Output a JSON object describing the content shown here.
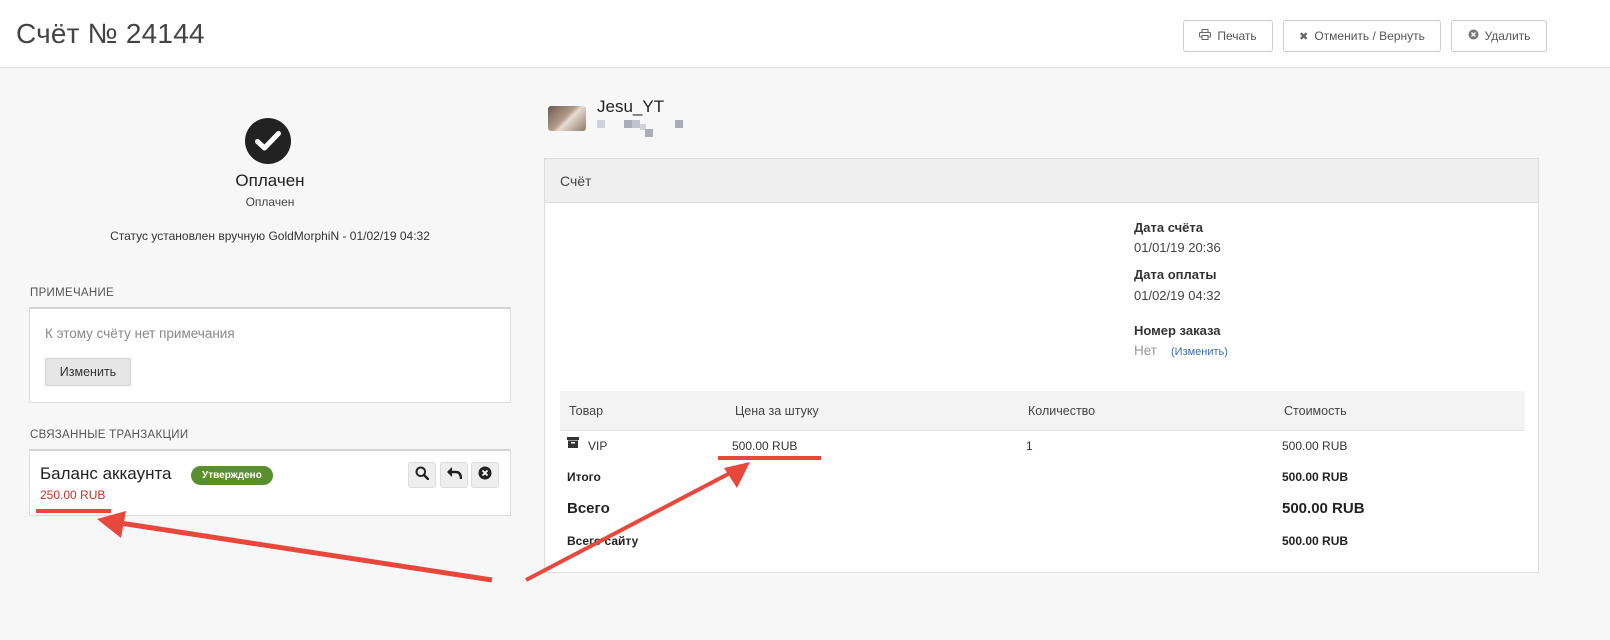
{
  "header": {
    "title": "Счёт № 24144",
    "buttons": {
      "print": "Печать",
      "cancel_refund": "Отменить / Вернуть",
      "delete": "Удалить"
    }
  },
  "status": {
    "title": "Оплачен",
    "subtitle": "Оплачен",
    "note": "Статус установлен вручную GoldMorphiN - 01/02/19 04:32"
  },
  "note_section": {
    "label": "ПРИМЕЧАНИЕ",
    "text": "К этому счёту нет примечания",
    "edit_button": "Изменить"
  },
  "transactions": {
    "label": "СВЯЗАННЫЕ ТРАНЗАКЦИИ",
    "items": [
      {
        "title": "Баланс аккаунта",
        "badge": "Утверждено",
        "amount": "250.00 RUB"
      }
    ]
  },
  "customer": {
    "name": "Jesu_YT"
  },
  "invoice": {
    "panel_title": "Счёт",
    "invoice_date_label": "Дата счёта",
    "invoice_date": "01/01/19 20:36",
    "payment_date_label": "Дата оплаты",
    "payment_date": "01/02/19 04:32",
    "order_number_label": "Номер заказа",
    "order_number": "Нет",
    "order_change_link": "(Изменить)",
    "columns": [
      "Товар",
      "Цена за штуку",
      "Количество",
      "Стоимость"
    ],
    "items": [
      {
        "name": "VIP",
        "price": "500.00 RUB",
        "qty": "1",
        "total": "500.00 RUB"
      }
    ],
    "subtotal_label": "Итого",
    "subtotal": "500.00 RUB",
    "total_label": "Всего",
    "total": "500.00 RUB",
    "site_total_label": "Всего сайту",
    "site_total": "500.00 RUB"
  },
  "colors": {
    "badge_approved": "#5a8f2e",
    "amount_red": "#c9302c",
    "annotation_red": "#e8473b",
    "link_blue": "#3a6fb0"
  }
}
